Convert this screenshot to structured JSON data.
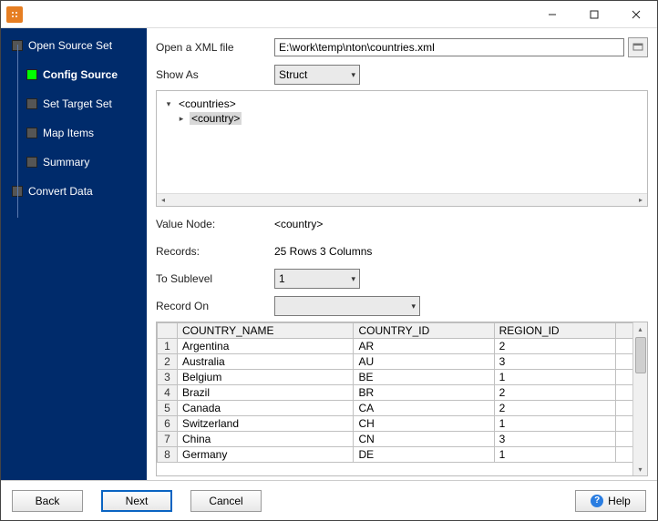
{
  "sidebar": {
    "items": [
      {
        "label": "Open Source Set",
        "level": 0,
        "active": false,
        "bold": false
      },
      {
        "label": "Config Source",
        "level": 1,
        "active": true,
        "bold": true
      },
      {
        "label": "Set Target Set",
        "level": 1,
        "active": false,
        "bold": false
      },
      {
        "label": "Map Items",
        "level": 1,
        "active": false,
        "bold": false
      },
      {
        "label": "Summary",
        "level": 1,
        "active": false,
        "bold": false
      },
      {
        "label": "Convert Data",
        "level": 0,
        "active": false,
        "bold": false
      }
    ]
  },
  "form": {
    "open_xml_label": "Open a XML file",
    "open_xml_value": "E:\\work\\temp\\nton\\countries.xml",
    "show_as_label": "Show As",
    "show_as_value": "Struct",
    "value_node_label": "Value Node:",
    "value_node_value": "<country>",
    "records_label": "Records:",
    "records_value": "25 Rows    3 Columns",
    "to_sublevel_label": "To Sublevel",
    "to_sublevel_value": "1",
    "record_on_label": "Record On",
    "record_on_value": ""
  },
  "tree": {
    "root": "<countries>",
    "child": "<country>"
  },
  "table": {
    "columns": [
      "COUNTRY_NAME",
      "COUNTRY_ID",
      "REGION_ID"
    ],
    "rows": [
      {
        "n": "1",
        "cells": [
          "Argentina",
          "AR",
          "2"
        ]
      },
      {
        "n": "2",
        "cells": [
          "Australia",
          "AU",
          "3"
        ]
      },
      {
        "n": "3",
        "cells": [
          "Belgium",
          "BE",
          "1"
        ]
      },
      {
        "n": "4",
        "cells": [
          "Brazil",
          "BR",
          "2"
        ]
      },
      {
        "n": "5",
        "cells": [
          "Canada",
          "CA",
          "2"
        ]
      },
      {
        "n": "6",
        "cells": [
          "Switzerland",
          "CH",
          "1"
        ]
      },
      {
        "n": "7",
        "cells": [
          "China",
          "CN",
          "3"
        ]
      },
      {
        "n": "8",
        "cells": [
          "Germany",
          "DE",
          "1"
        ]
      }
    ]
  },
  "footer": {
    "back": "Back",
    "next": "Next",
    "cancel": "Cancel",
    "help": "Help"
  }
}
